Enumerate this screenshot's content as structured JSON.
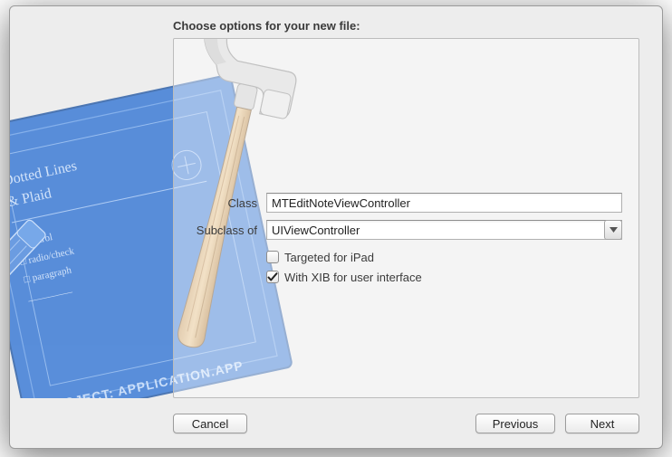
{
  "title": "Choose options for your new file:",
  "labels": {
    "class": "Class",
    "subclass": "Subclass of"
  },
  "fields": {
    "class_value": "MTEditNoteViewController",
    "subclass_value": "UIViewController"
  },
  "checkboxes": {
    "ipad": {
      "label": "Targeted for iPad",
      "checked": false
    },
    "xib": {
      "label": "With XIB for user interface",
      "checked": true
    }
  },
  "buttons": {
    "cancel": "Cancel",
    "previous": "Previous",
    "next": "Next"
  }
}
